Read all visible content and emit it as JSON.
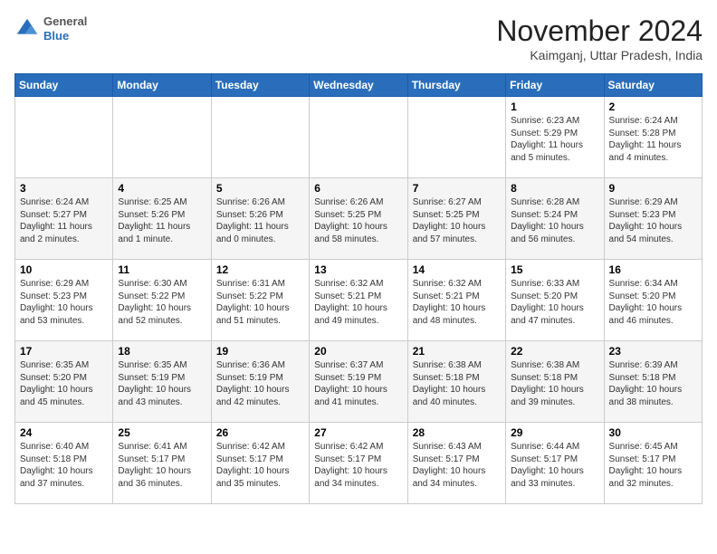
{
  "header": {
    "logo": {
      "general": "General",
      "blue": "Blue"
    },
    "title": "November 2024",
    "location": "Kaimganj, Uttar Pradesh, India"
  },
  "calendar": {
    "weekdays": [
      "Sunday",
      "Monday",
      "Tuesday",
      "Wednesday",
      "Thursday",
      "Friday",
      "Saturday"
    ],
    "weeks": [
      [
        {
          "day": "",
          "info": ""
        },
        {
          "day": "",
          "info": ""
        },
        {
          "day": "",
          "info": ""
        },
        {
          "day": "",
          "info": ""
        },
        {
          "day": "",
          "info": ""
        },
        {
          "day": "1",
          "info": "Sunrise: 6:23 AM\nSunset: 5:29 PM\nDaylight: 11 hours\nand 5 minutes."
        },
        {
          "day": "2",
          "info": "Sunrise: 6:24 AM\nSunset: 5:28 PM\nDaylight: 11 hours\nand 4 minutes."
        }
      ],
      [
        {
          "day": "3",
          "info": "Sunrise: 6:24 AM\nSunset: 5:27 PM\nDaylight: 11 hours\nand 2 minutes."
        },
        {
          "day": "4",
          "info": "Sunrise: 6:25 AM\nSunset: 5:26 PM\nDaylight: 11 hours\nand 1 minute."
        },
        {
          "day": "5",
          "info": "Sunrise: 6:26 AM\nSunset: 5:26 PM\nDaylight: 11 hours\nand 0 minutes."
        },
        {
          "day": "6",
          "info": "Sunrise: 6:26 AM\nSunset: 5:25 PM\nDaylight: 10 hours\nand 58 minutes."
        },
        {
          "day": "7",
          "info": "Sunrise: 6:27 AM\nSunset: 5:25 PM\nDaylight: 10 hours\nand 57 minutes."
        },
        {
          "day": "8",
          "info": "Sunrise: 6:28 AM\nSunset: 5:24 PM\nDaylight: 10 hours\nand 56 minutes."
        },
        {
          "day": "9",
          "info": "Sunrise: 6:29 AM\nSunset: 5:23 PM\nDaylight: 10 hours\nand 54 minutes."
        }
      ],
      [
        {
          "day": "10",
          "info": "Sunrise: 6:29 AM\nSunset: 5:23 PM\nDaylight: 10 hours\nand 53 minutes."
        },
        {
          "day": "11",
          "info": "Sunrise: 6:30 AM\nSunset: 5:22 PM\nDaylight: 10 hours\nand 52 minutes."
        },
        {
          "day": "12",
          "info": "Sunrise: 6:31 AM\nSunset: 5:22 PM\nDaylight: 10 hours\nand 51 minutes."
        },
        {
          "day": "13",
          "info": "Sunrise: 6:32 AM\nSunset: 5:21 PM\nDaylight: 10 hours\nand 49 minutes."
        },
        {
          "day": "14",
          "info": "Sunrise: 6:32 AM\nSunset: 5:21 PM\nDaylight: 10 hours\nand 48 minutes."
        },
        {
          "day": "15",
          "info": "Sunrise: 6:33 AM\nSunset: 5:20 PM\nDaylight: 10 hours\nand 47 minutes."
        },
        {
          "day": "16",
          "info": "Sunrise: 6:34 AM\nSunset: 5:20 PM\nDaylight: 10 hours\nand 46 minutes."
        }
      ],
      [
        {
          "day": "17",
          "info": "Sunrise: 6:35 AM\nSunset: 5:20 PM\nDaylight: 10 hours\nand 45 minutes."
        },
        {
          "day": "18",
          "info": "Sunrise: 6:35 AM\nSunset: 5:19 PM\nDaylight: 10 hours\nand 43 minutes."
        },
        {
          "day": "19",
          "info": "Sunrise: 6:36 AM\nSunset: 5:19 PM\nDaylight: 10 hours\nand 42 minutes."
        },
        {
          "day": "20",
          "info": "Sunrise: 6:37 AM\nSunset: 5:19 PM\nDaylight: 10 hours\nand 41 minutes."
        },
        {
          "day": "21",
          "info": "Sunrise: 6:38 AM\nSunset: 5:18 PM\nDaylight: 10 hours\nand 40 minutes."
        },
        {
          "day": "22",
          "info": "Sunrise: 6:38 AM\nSunset: 5:18 PM\nDaylight: 10 hours\nand 39 minutes."
        },
        {
          "day": "23",
          "info": "Sunrise: 6:39 AM\nSunset: 5:18 PM\nDaylight: 10 hours\nand 38 minutes."
        }
      ],
      [
        {
          "day": "24",
          "info": "Sunrise: 6:40 AM\nSunset: 5:18 PM\nDaylight: 10 hours\nand 37 minutes."
        },
        {
          "day": "25",
          "info": "Sunrise: 6:41 AM\nSunset: 5:17 PM\nDaylight: 10 hours\nand 36 minutes."
        },
        {
          "day": "26",
          "info": "Sunrise: 6:42 AM\nSunset: 5:17 PM\nDaylight: 10 hours\nand 35 minutes."
        },
        {
          "day": "27",
          "info": "Sunrise: 6:42 AM\nSunset: 5:17 PM\nDaylight: 10 hours\nand 34 minutes."
        },
        {
          "day": "28",
          "info": "Sunrise: 6:43 AM\nSunset: 5:17 PM\nDaylight: 10 hours\nand 34 minutes."
        },
        {
          "day": "29",
          "info": "Sunrise: 6:44 AM\nSunset: 5:17 PM\nDaylight: 10 hours\nand 33 minutes."
        },
        {
          "day": "30",
          "info": "Sunrise: 6:45 AM\nSunset: 5:17 PM\nDaylight: 10 hours\nand 32 minutes."
        }
      ]
    ]
  }
}
